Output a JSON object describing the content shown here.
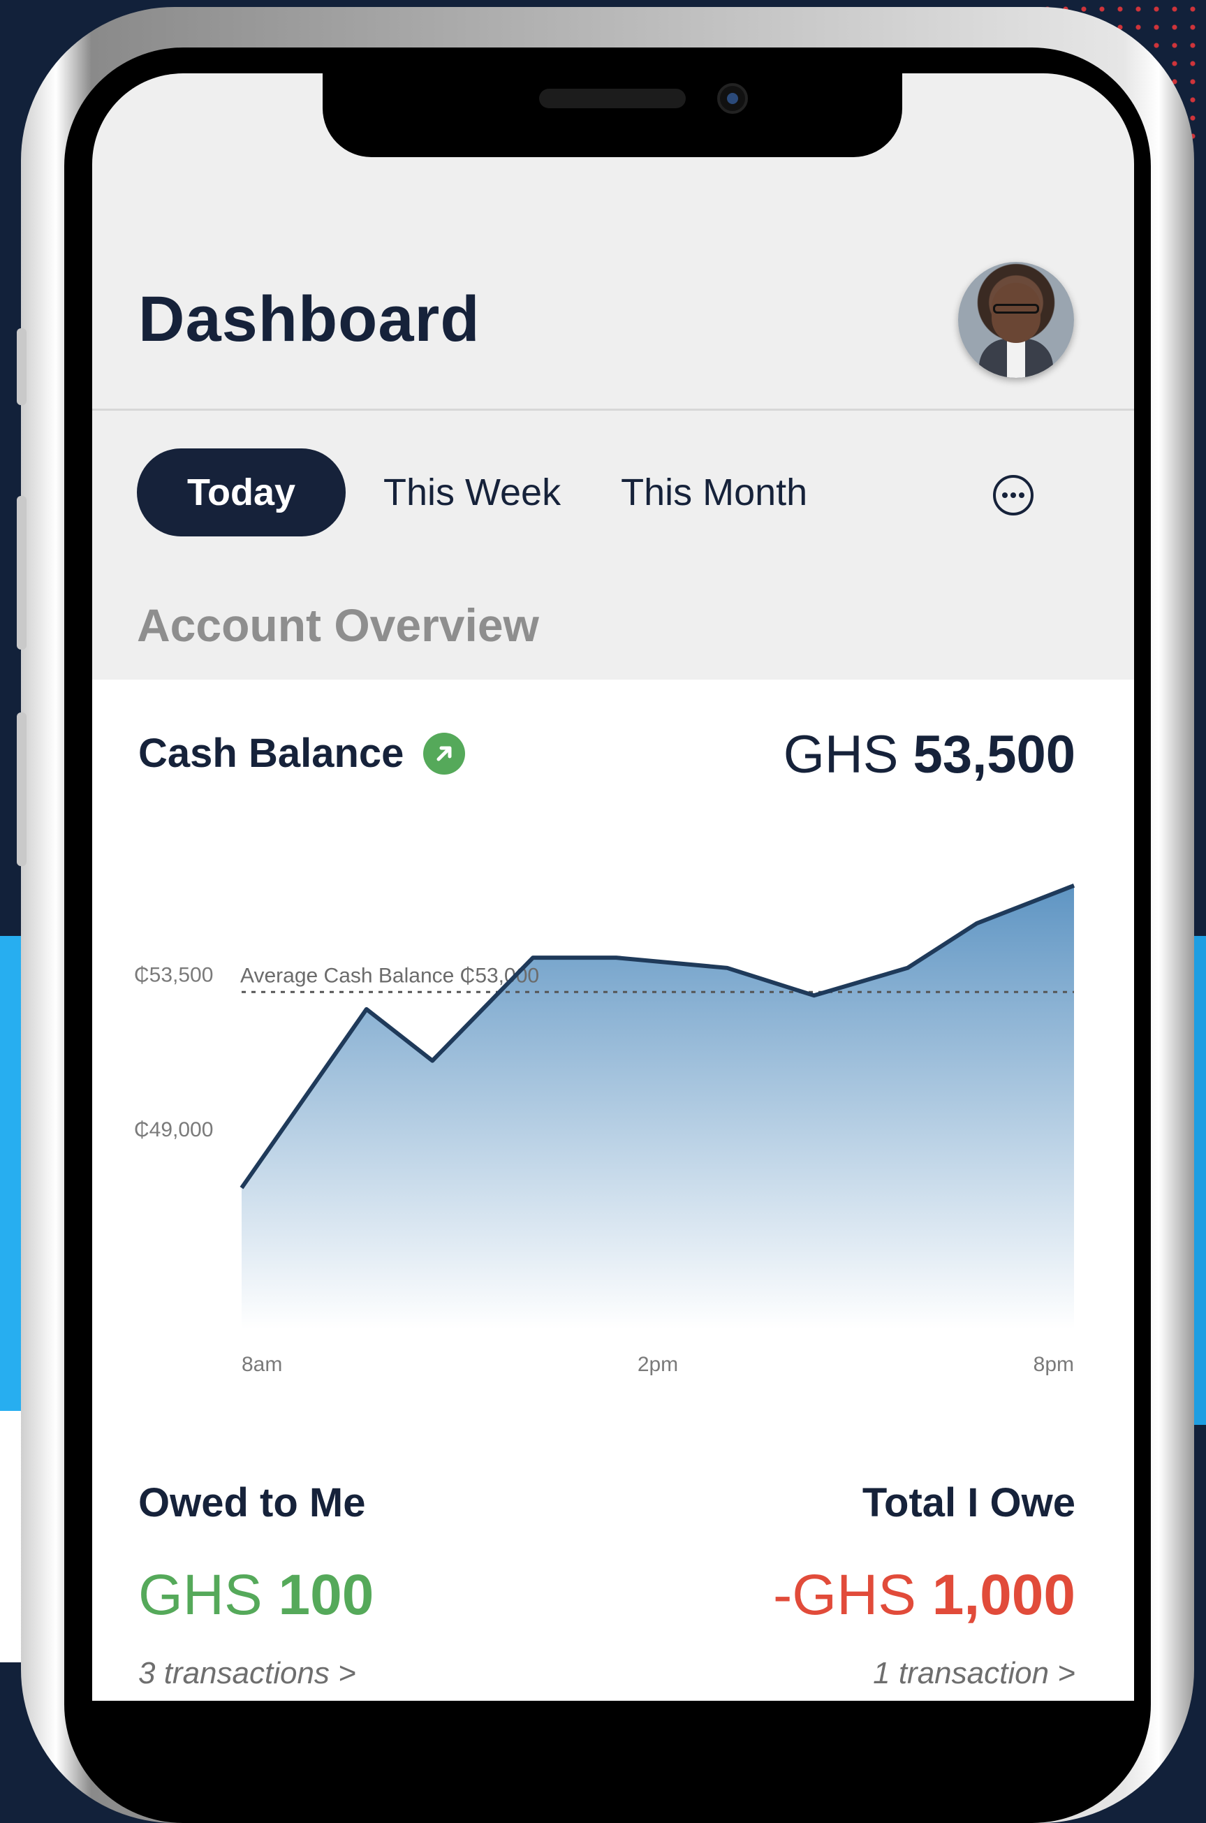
{
  "header": {
    "title": "Dashboard"
  },
  "tabs": [
    {
      "label": "Today",
      "active": true
    },
    {
      "label": "This Week",
      "active": false
    },
    {
      "label": "This Month",
      "active": false
    }
  ],
  "more_icon": "more-horizontal-icon",
  "section_title": "Account Overview",
  "cash_balance": {
    "label": "Cash Balance",
    "trend_icon": "arrow-up-right-icon",
    "currency": "GHS",
    "amount": "53,500"
  },
  "chart_data": {
    "type": "area",
    "average_label": "Average Cash Balance ₵53,000",
    "average_value": 53000,
    "y_tick_labels": [
      "₵53,500",
      "₵49,000"
    ],
    "y_ticks": [
      53500,
      49000
    ],
    "x_tick_labels": [
      "8am",
      "2pm",
      "8pm"
    ],
    "x": [
      8,
      9.8,
      10.75,
      12.2,
      13.4,
      15.0,
      16.25,
      17.6,
      18.6,
      20
    ],
    "values": [
      47300,
      52500,
      51000,
      54000,
      54000,
      53700,
      52900,
      53700,
      55000,
      56100
    ],
    "ylim": [
      44000,
      56400
    ],
    "xlim": [
      8,
      20
    ],
    "line_color": "#1f3a5a",
    "fill_color": "#5f95c3"
  },
  "owed_to_me": {
    "label": "Owed to Me",
    "currency": "GHS",
    "amount": "100",
    "transactions": "3 transactions >",
    "color": "#55a95a"
  },
  "total_i_owe": {
    "label": "Total I Owe",
    "currency": "-GHS",
    "amount": "1,000",
    "transactions": "1 transaction >",
    "color": "#e14b3a"
  }
}
